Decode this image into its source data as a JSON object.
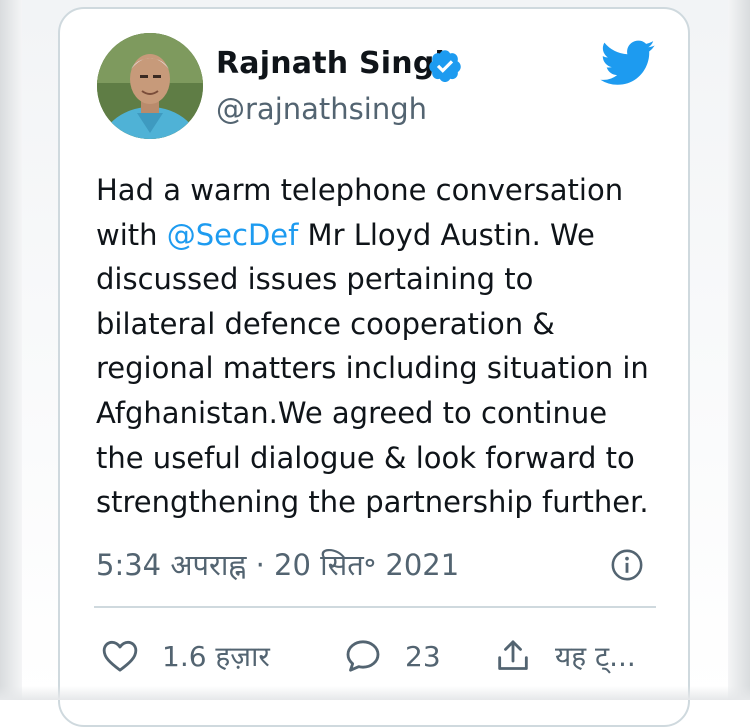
{
  "author": {
    "name": "Rajnath Singh",
    "handle": "@rajnathsingh",
    "verified": true,
    "avatar_icon": "profile-photo"
  },
  "logo_icon": "twitter-bird-icon",
  "colors": {
    "accent": "#1d9bf0",
    "text": "#0f1419",
    "secondary": "#536471",
    "border": "#cfd9de"
  },
  "tweet": {
    "lines": [
      {
        "text": "Had a warm telephone conversation"
      },
      {
        "before": "with ",
        "mention": "@SecDef",
        "after": " Mr Lloyd Austin. We"
      },
      {
        "text": "discussed issues pertaining to"
      },
      {
        "text": "bilateral defence cooperation &"
      },
      {
        "text": "regional matters including situation in"
      },
      {
        "text": "Afghanistan.We agreed to continue"
      },
      {
        "text": "the useful dialogue & look forward to"
      },
      {
        "text": "strengthening the partnership further."
      }
    ],
    "timestamp": "5:34 अपराह्न · 20 सित॰ 2021"
  },
  "actions": {
    "likes": "1.6 हज़ार",
    "replies": "23",
    "share_label": "यह ट्..."
  }
}
